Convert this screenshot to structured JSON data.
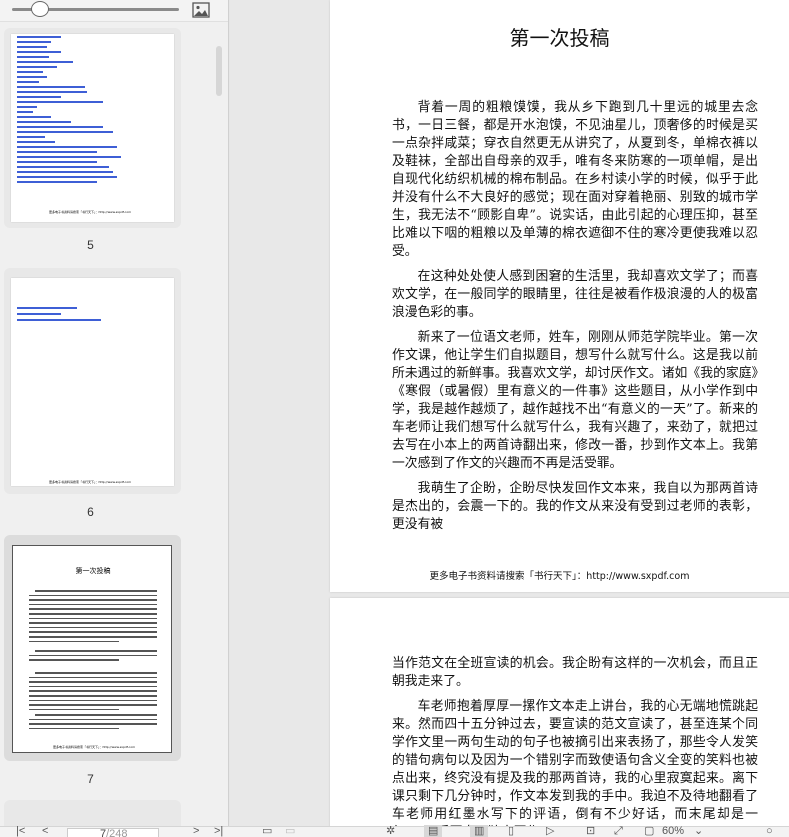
{
  "sidebar": {
    "thumbnails": [
      {
        "number": "5",
        "footer": "更多电子书资料请搜索「书行天下」：http://www.sxpdf.com"
      },
      {
        "number": "6",
        "footer": "更多电子书资料请搜索「书行天下」：http://www.sxpdf.com"
      },
      {
        "number": "7",
        "title": "第一次投稿",
        "footer": "更多电子书资料请搜索「书行天下」：http://www.sxpdf.com"
      }
    ]
  },
  "document": {
    "page1": {
      "title": "第一次投稿",
      "paragraphs": [
        "背着一周的粗粮馍馍，我从乡下跑到几十里远的城里去念书，一日三餐，都是开水泡馍，不见油星儿，顶奢侈的时候是买一点杂拌咸菜；穿衣自然更无从讲究了，从夏到冬，单棉衣裤以及鞋袜，全部出自母亲的双手，唯有冬来防寒的一项单帽，是出自现代化纺织机械的棉布制品。在乡村读小学的时候，似乎于此并没有什么不大良好的感觉；现在面对穿着艳丽、别致的城市学生，我无法不“顾影自卑”。说实话，由此引起的心理压抑，甚至比难以下咽的粗粮以及单薄的棉衣遮御不住的寒冷更使我难以忍受。",
        "在这种处处使人感到困窘的生活里，我却喜欢文学了；而喜欢文学，在一般同学的眼睛里，往往是被看作极浪漫的人的极富浪漫色彩的事。",
        "新来了一位语文老师，姓车，刚刚从师范学院毕业。第一次作文课，他让学生们自拟题目，想写什么就写什么。这是我以前所未遇过的新鲜事。我喜欢文学，却讨厌作文。诸如《我的家庭》《寒假（或暑假）里有意义的一件事》这些题目，从小学作到中学，我是越作越烦了，越作越找不出“有意义的一天”了。新来的车老师让我们想写什么就写什么，我有兴趣了，来劲了，就把过去写在小本上的两首诗翻出来，修改一番，抄到作文本上。我第一次感到了作文的兴趣而不再是活受罪。",
        "我萌生了企盼，企盼尽快发回作文本来，我自以为那两首诗是杰出的，会震一下的。我的作文从来没有受到过老师的表彰，更没有被"
      ],
      "footer": "更多电子书资料请搜索「书行天下」：http://www.sxpdf.com"
    },
    "page2": {
      "paragraphs": [
        "当作范文在全班宣读的机会。我企盼有这样的一次机会，而且正朝我走来了。",
        "车老师抱着厚厚一摞作文本走上讲台，我的心无端地慌跳起来。然而四十五分钟过去，要宣读的范文宣读了，甚至连某个同学作文里一两句生动的句子也被摘引出来表扬了，那些令人发笑的错句病句以及因为一个错别字而致使语句含义全变的笑料也被点出来，终究没有提及我的那两首诗，我的心里寂寞起来。离下课只剩下几分钟时，作文本发到我的手中。我迫不及待地翻看了车老师用红墨水写下的评语，倒有不少好话，而末尾却是一句：“以后要自己独立写作。”"
      ]
    }
  },
  "bottombar": {
    "page_current": "7",
    "page_total": "/248",
    "zoom": "60%"
  },
  "colors": {
    "link": "#3e5fd6",
    "background": "#e8e8e8",
    "panel": "#f0f0f0"
  }
}
